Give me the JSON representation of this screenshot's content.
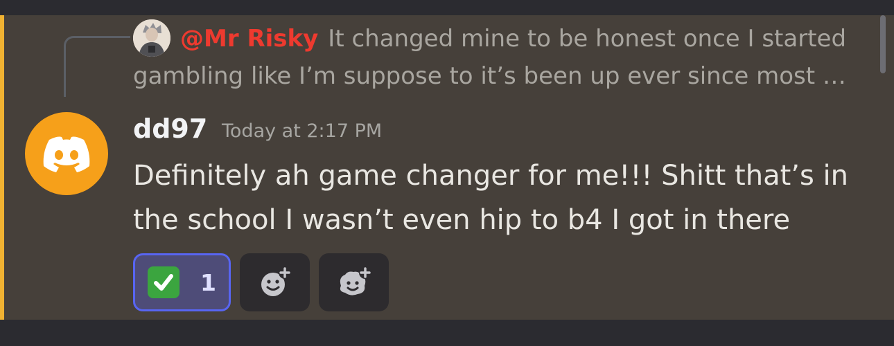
{
  "reply": {
    "author": "@Mr Risky",
    "line1": "It changed mine to be honest once I started",
    "line2": "gambling like I’m suppose to it’s been up ever since most …"
  },
  "message": {
    "author": "dd97",
    "timestamp": "Today at 2:17 PM",
    "content": "Definitely ah game changer for me!!! Shitt that’s in the school I wasn’t even hip to b4 I got in there"
  },
  "reactions": [
    {
      "emoji": "white-check-mark",
      "count": "1"
    }
  ],
  "colors": {
    "highlight": "#f0b232",
    "mention": "#ee3a2f",
    "avatar_bg": "#f6a01a",
    "reaction_active_border": "#5865f2",
    "reaction_emoji": "#3ba53f"
  }
}
